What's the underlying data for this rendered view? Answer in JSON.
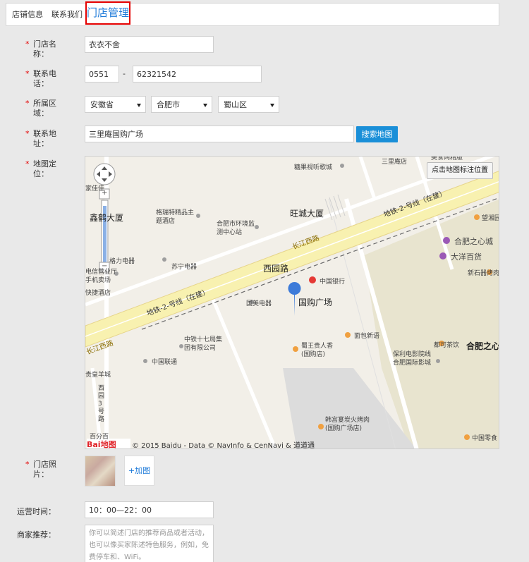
{
  "tabs": {
    "shop_info": "店铺信息",
    "contact_us": "联系我们",
    "store_manage": "门店管理"
  },
  "form": {
    "required_mark": "*",
    "store_name": {
      "label": "门店名称：",
      "value": "衣衣不舍"
    },
    "phone": {
      "label": "联系电话：",
      "area_code": "0551",
      "separator": "-",
      "number": "62321542"
    },
    "region": {
      "label": "所属区域：",
      "province": "安徽省",
      "city": "合肥市",
      "district": "蜀山区"
    },
    "address": {
      "label": "联系地址：",
      "value": "三里庵国购广场",
      "search_button": "搜索地图"
    },
    "map_location": {
      "label": "地图定位："
    },
    "photos": {
      "label": "门店照片：",
      "add_button": "+加图"
    },
    "hours": {
      "label": "运营时间：",
      "value": "10：00—22：00"
    },
    "recommend": {
      "label": "商家推荐：",
      "placeholder": "你可以简述门店的推荐商品或者活动，也可以像买家陈述特色服务，例如，免费停车和、WiFi。"
    }
  },
  "map": {
    "mark_button": "点击地图标注位置",
    "zoom_in": "+",
    "zoom_out": "−",
    "copyright": "© 2015 Baidu - Data © NavInfo & CenNavi & 道道通",
    "logo_text": "Bai地图",
    "labels": {
      "l1": "糖果视听歌城",
      "l2": "三里庵店",
      "l3": "美食网精版",
      "l4": "格瑞特精品主题酒店",
      "l5": "合肥市环境监测中心站",
      "l6": "旺城大厦",
      "l7": "鑫鹤大厦",
      "l8": "格力电器",
      "l9": "苏宁电器",
      "l10": "手机卖场",
      "l11": "电信营业厅",
      "l12": "快捷酒店",
      "l13": "西园路",
      "l14": "中国银行",
      "l15": "国美电器",
      "l16": "国购广场",
      "l17": "长江西路",
      "l18": "长江西路",
      "l19": "地铁-2-号线（在建）",
      "l20": "地铁-2-号线（在建）",
      "l21": "中铁十七局集团有限公司",
      "l22": "中国联通",
      "l23": "贵皇羊城",
      "l24": "西园3号路",
      "l25": "面包新语",
      "l26": "蜀王贵人香(国购店)",
      "l27": "都可茶饮",
      "l28": "保利电影院线合肥国际影城",
      "l29": "韩宫宴炭火烤肉(国购广场店)",
      "l30": "合肥之心城",
      "l31": "大洋百货",
      "l32": "新石器烤肉",
      "l33": "望湘园",
      "l34": "合肥之心",
      "l35": "中国零食",
      "l36": "百分百",
      "l37": "长江西路",
      "l38": "家佳佳"
    }
  }
}
